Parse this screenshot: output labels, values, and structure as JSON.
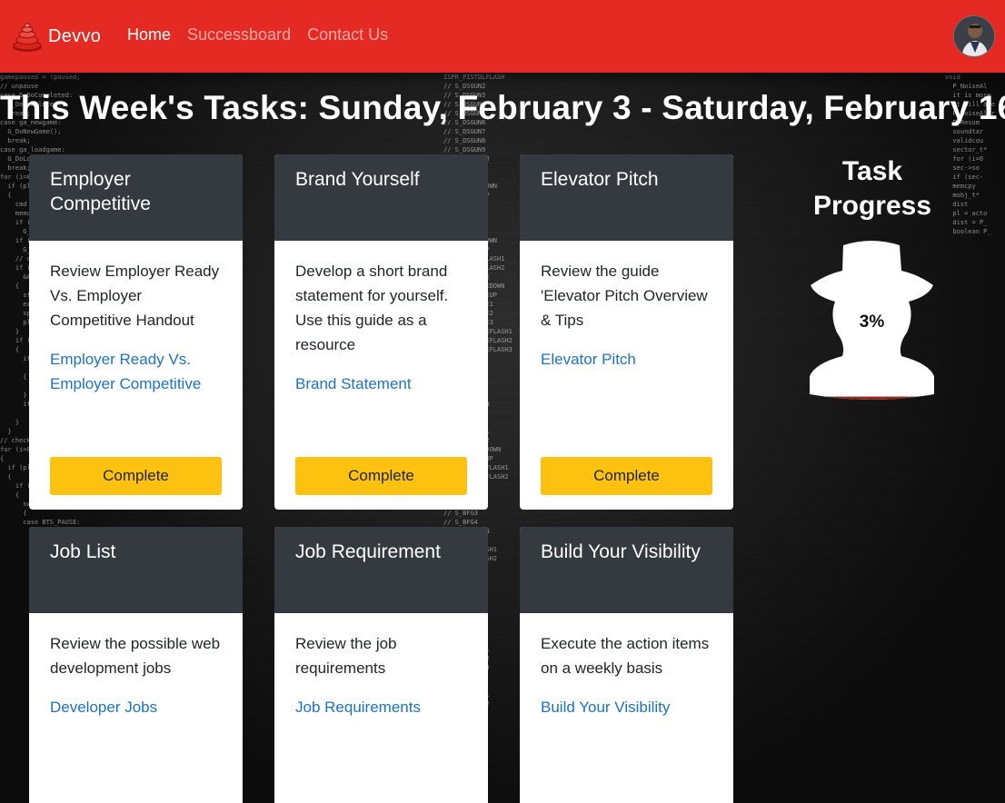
{
  "navbar": {
    "brand": "Devvo",
    "links": [
      {
        "label": "Home",
        "active": true
      },
      {
        "label": "Successboard",
        "active": false
      },
      {
        "label": "Contact Us",
        "active": false
      }
    ],
    "avatar_icon": "user-avatar"
  },
  "page": {
    "title": "This Week's Tasks: Sunday, February 3 - Saturday, February 16"
  },
  "tasks": [
    {
      "title": "Employer Competitive",
      "description": "Review Employer Ready Vs. Employer Competitive Handout",
      "link": "Employer Ready Vs. Employer Competitive",
      "button": "Complete"
    },
    {
      "title": "Brand Yourself",
      "description": "Develop a short brand statement for yourself. Use this guide as a resource",
      "link": "Brand Statement",
      "button": "Complete"
    },
    {
      "title": "Elevator Pitch",
      "description": "Review the guide 'Elevator Pitch Overview & Tips",
      "link": "Elevator Pitch",
      "button": "Complete"
    },
    {
      "title": "Job List",
      "description": "Review the possible web development jobs",
      "link": "Developer Jobs"
    },
    {
      "title": "Job Requirement",
      "description": "Review the job requirements",
      "link": "Job Requirements"
    },
    {
      "title": "Build Your Visibility",
      "description": "Execute the action items on a weekly basis",
      "link": "Build Your Visibility"
    }
  ],
  "progress": {
    "title": "Task Progress",
    "value_label": "3%",
    "fraction": 0.03
  },
  "colors": {
    "navbar": "#e52a24",
    "card_header": "#343a40",
    "button": "#fdc210",
    "link": "#1a73c9",
    "progress_fill": "#8b2a1a"
  }
}
